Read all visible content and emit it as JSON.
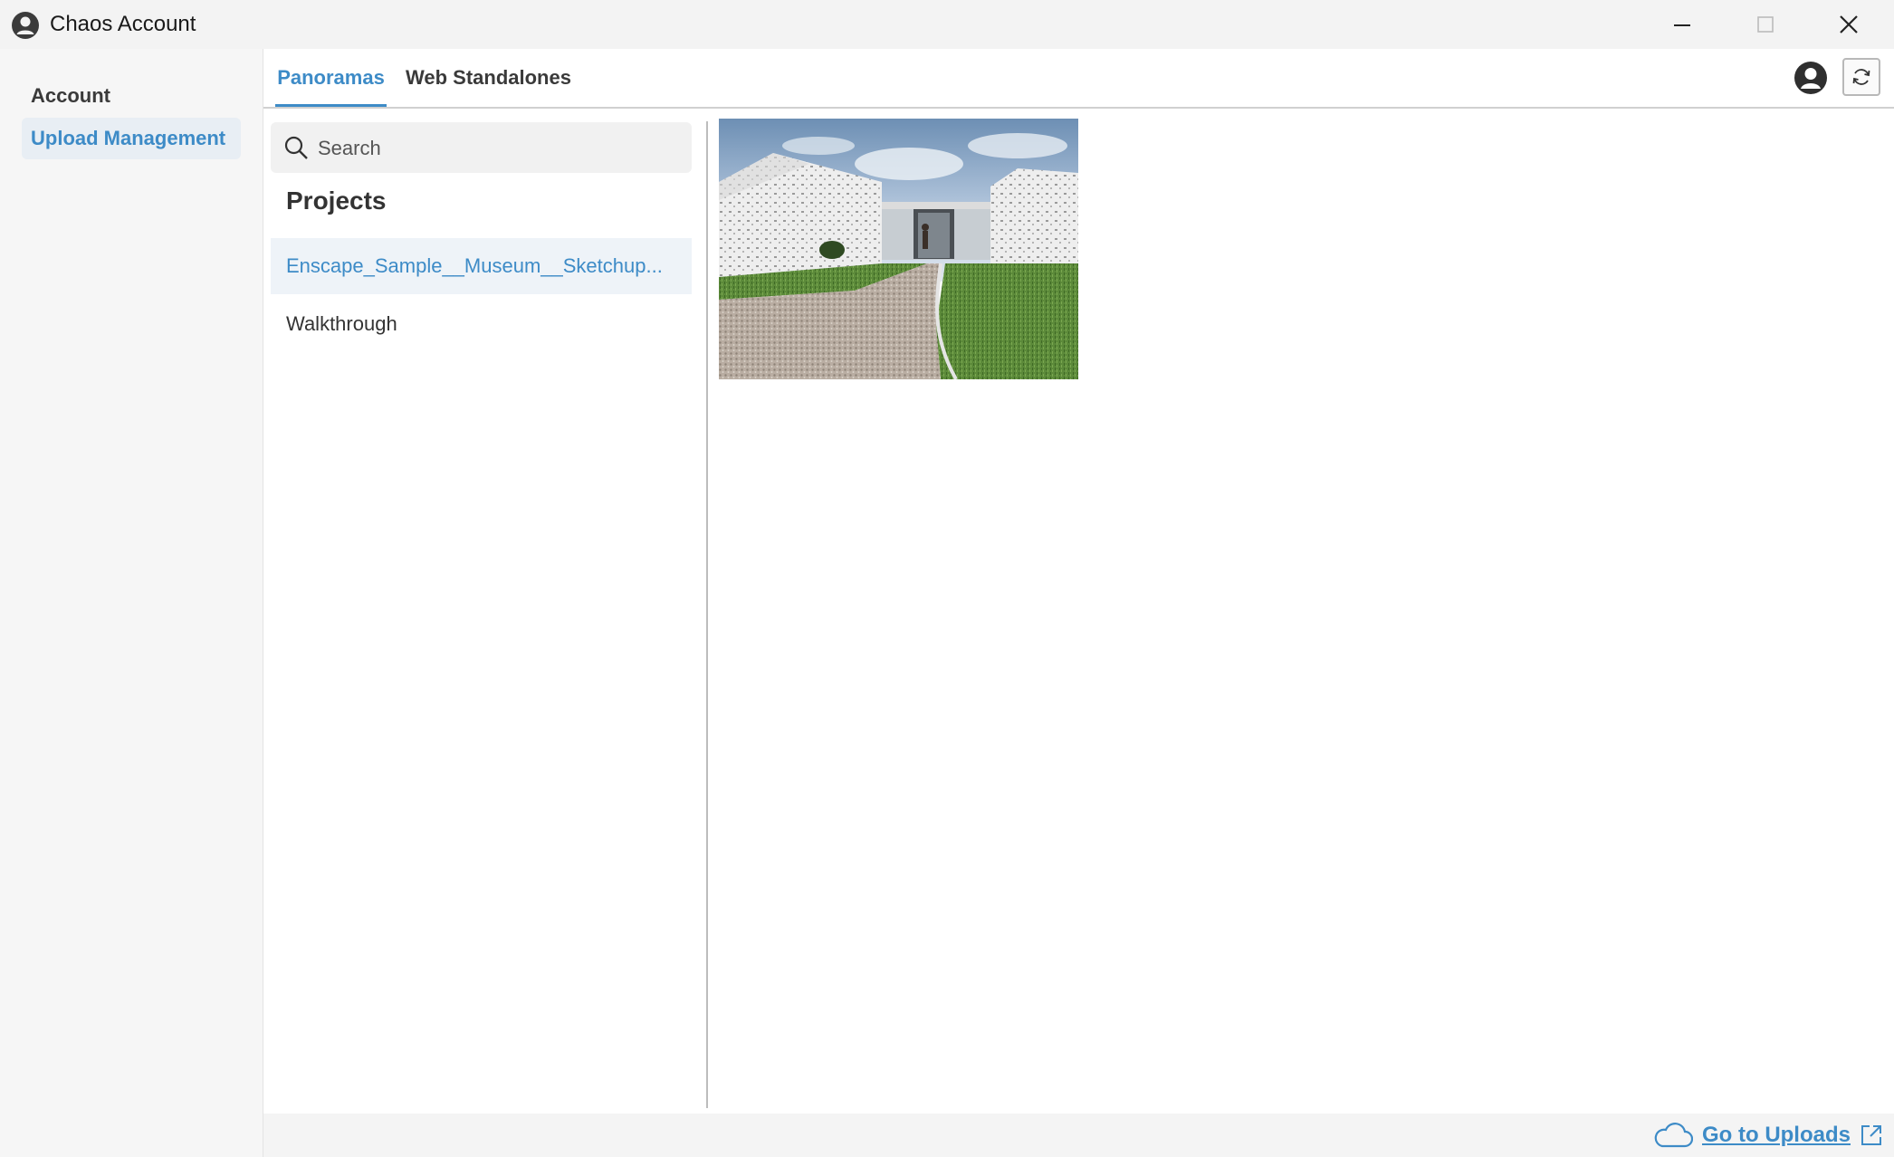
{
  "window": {
    "title": "Chaos Account",
    "icons": {
      "app": "user-circle-icon",
      "minimize": "minimize-icon",
      "maximize": "maximize-icon",
      "close": "close-icon"
    }
  },
  "sidebar": {
    "items": [
      {
        "label": "Account",
        "active": false
      },
      {
        "label": "Upload Management",
        "active": true
      }
    ]
  },
  "tabs": [
    {
      "label": "Panoramas",
      "active": true
    },
    {
      "label": "Web Standalones",
      "active": false
    }
  ],
  "header_icons": {
    "avatar": "user-circle-icon",
    "refresh": "refresh-icon"
  },
  "search": {
    "placeholder": "Search",
    "value": ""
  },
  "projects": {
    "heading": "Projects",
    "items": [
      {
        "label": "Enscape_Sample__Museum__Sketchup...",
        "selected": true
      },
      {
        "label": "Walkthrough",
        "selected": false
      }
    ]
  },
  "footer": {
    "link_label": "Go to Uploads",
    "icons": [
      "cloud-icon",
      "external-link-icon"
    ]
  },
  "colors": {
    "accent": "#3d8bc7",
    "titlebar": "#f3f3f3",
    "sidebar": "#f6f6f6"
  }
}
